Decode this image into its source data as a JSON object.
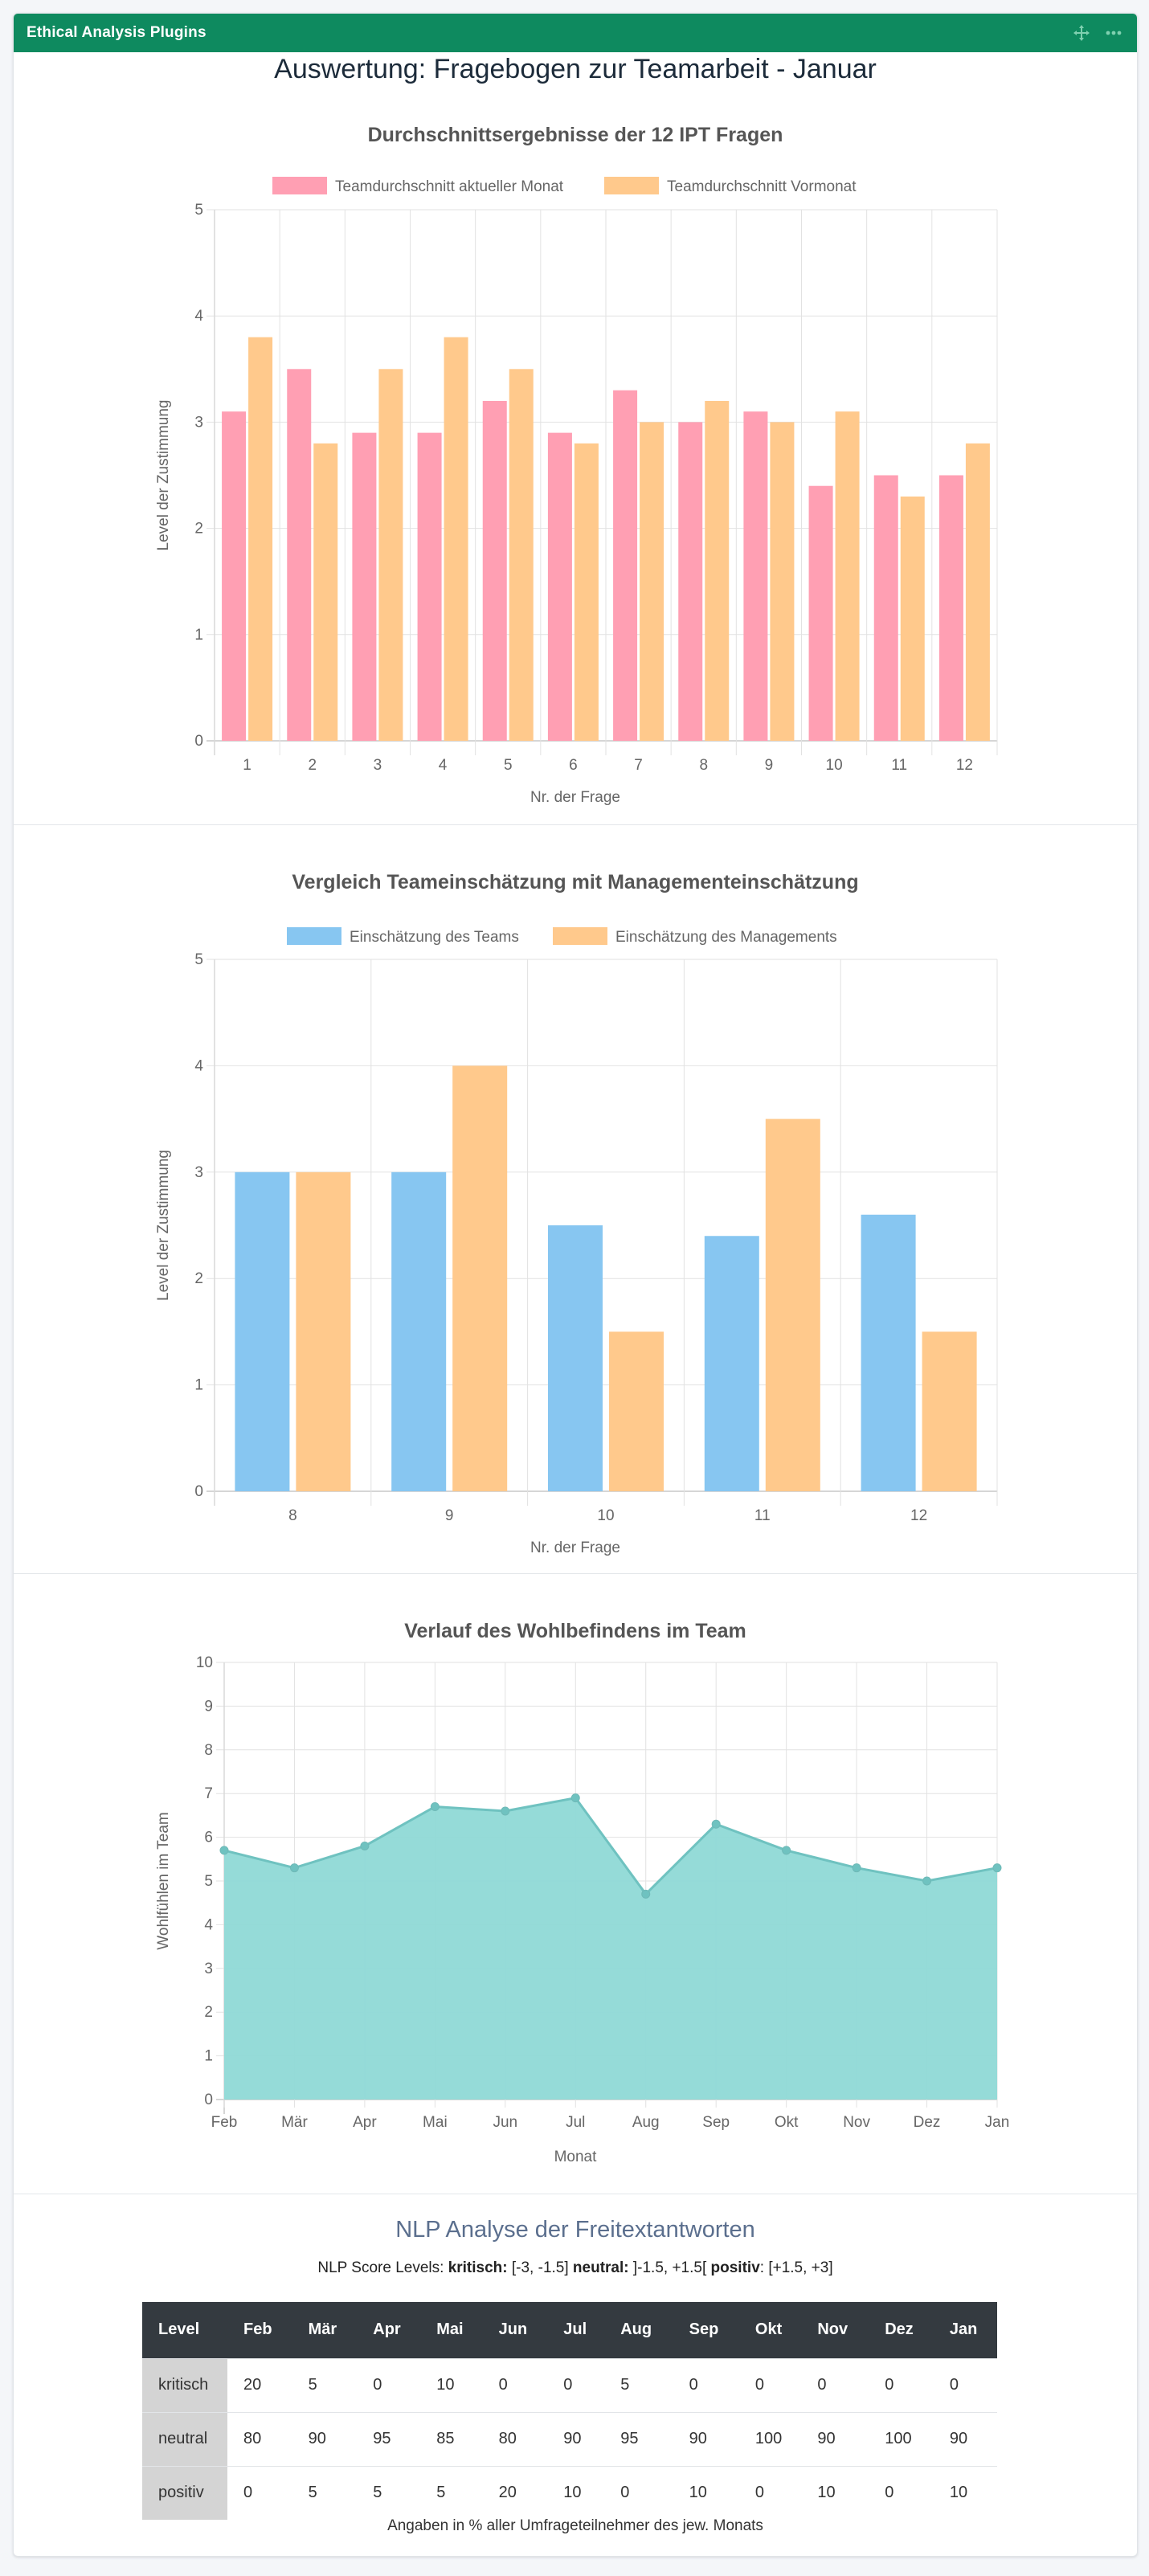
{
  "panel": {
    "title": "Ethical Analysis Plugins",
    "icons": [
      "move-icon",
      "more-icon"
    ]
  },
  "report_title": "Auswertung: Fragebogen zur Teamarbeit - Januar",
  "colors": {
    "header": "#0e8a5f",
    "pink": "#ff9fb3",
    "orange": "#ffc98c",
    "blue": "#87c6f1",
    "teal": "#8fd9d6",
    "teal_line": "#6fc2c0",
    "table_header": "#343a40"
  },
  "chart_data": [
    {
      "type": "bar",
      "title": "Durchschnittsergebnisse der 12 IPT Fragen",
      "xlabel": "Nr. der Frage",
      "ylabel": "Level der Zustimmung",
      "ylim": [
        0,
        5
      ],
      "yticks": [
        0,
        1,
        2,
        3,
        4,
        5
      ],
      "grid": true,
      "legend": "top",
      "categories": [
        "1",
        "2",
        "3",
        "4",
        "5",
        "6",
        "7",
        "8",
        "9",
        "10",
        "11",
        "12"
      ],
      "series": [
        {
          "name": "Teamdurchschnitt aktueller Monat",
          "color": "#ff9fb3",
          "values": [
            3.1,
            3.5,
            2.9,
            2.9,
            3.2,
            2.9,
            3.3,
            3.0,
            3.1,
            2.4,
            2.5,
            2.5
          ]
        },
        {
          "name": "Teamdurchschnitt Vormonat",
          "color": "#ffc98c",
          "values": [
            3.8,
            2.8,
            3.5,
            3.8,
            3.5,
            2.8,
            3.0,
            3.2,
            3.0,
            3.1,
            2.3,
            2.8
          ]
        }
      ]
    },
    {
      "type": "bar",
      "title": "Vergleich Teameinschätzung mit Managementeinschätzung",
      "xlabel": "Nr. der Frage",
      "ylabel": "Level der Zustimmung",
      "ylim": [
        0,
        5
      ],
      "yticks": [
        0,
        1,
        2,
        3,
        4,
        5
      ],
      "grid": true,
      "legend": "top",
      "categories": [
        "8",
        "9",
        "10",
        "11",
        "12"
      ],
      "series": [
        {
          "name": "Einschätzung des Teams",
          "color": "#87c6f1",
          "values": [
            3.0,
            3.0,
            2.5,
            2.4,
            2.6
          ]
        },
        {
          "name": "Einschätzung des Managements",
          "color": "#ffc98c",
          "values": [
            3.0,
            4.0,
            1.5,
            3.5,
            1.5
          ]
        }
      ]
    },
    {
      "type": "area",
      "title": "Verlauf des Wohlbefindens im Team",
      "xlabel": "Monat",
      "ylabel": "Wohlfühlen im Team",
      "ylim": [
        0,
        10
      ],
      "yticks": [
        0,
        1,
        2,
        3,
        4,
        5,
        6,
        7,
        8,
        9,
        10
      ],
      "grid": true,
      "categories": [
        "Feb",
        "Mär",
        "Apr",
        "Mai",
        "Jun",
        "Jul",
        "Aug",
        "Sep",
        "Okt",
        "Nov",
        "Dez",
        "Jan"
      ],
      "series": [
        {
          "color": "#8fd9d6",
          "values": [
            5.7,
            5.3,
            5.8,
            6.7,
            6.6,
            6.9,
            4.7,
            6.3,
            5.7,
            5.3,
            5.0,
            5.3
          ]
        }
      ]
    }
  ],
  "nlp": {
    "title": "NLP Analyse der Freitextantworten",
    "levels_prefix": "NLP Score Levels: ",
    "kritisch_label": "kritisch:",
    "kritisch_range": " [-3, -1.5] ",
    "neutral_label": "neutral:",
    "neutral_range": " ]-1.5, +1.5[ ",
    "positiv_label": "positiv",
    "positiv_range": ": [+1.5, +3]",
    "columns": [
      "Level",
      "Feb",
      "Mär",
      "Apr",
      "Mai",
      "Jun",
      "Jul",
      "Aug",
      "Sep",
      "Okt",
      "Nov",
      "Dez",
      "Jan"
    ],
    "rows": [
      [
        "kritisch",
        "20",
        "5",
        "0",
        "10",
        "0",
        "0",
        "5",
        "0",
        "0",
        "0",
        "0",
        "0"
      ],
      [
        "neutral",
        "80",
        "90",
        "95",
        "85",
        "80",
        "90",
        "95",
        "90",
        "100",
        "90",
        "100",
        "90"
      ],
      [
        "positiv",
        "0",
        "5",
        "5",
        "5",
        "20",
        "10",
        "0",
        "10",
        "0",
        "10",
        "0",
        "10"
      ]
    ],
    "note": "Angaben in % aller Umfrageteilnehmer des jew. Monats"
  }
}
